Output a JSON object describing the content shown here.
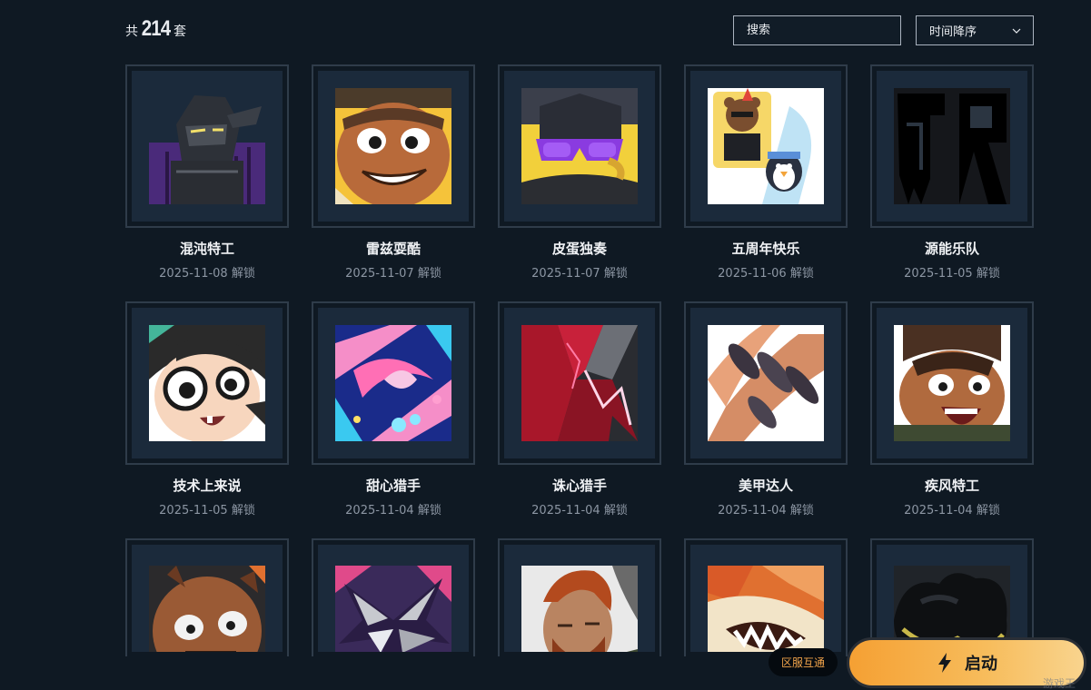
{
  "header": {
    "count_prefix": "共",
    "count_number": "214",
    "count_suffix": "套",
    "search_placeholder": "搜索",
    "sort_label": "时间降序"
  },
  "cards": [
    {
      "name": "混沌特工",
      "date": "2025-11-08 解锁",
      "art": "armor-robot"
    },
    {
      "name": "雷兹耍酷",
      "date": "2025-11-07 解锁",
      "art": "grin-face"
    },
    {
      "name": "皮蛋独奏",
      "date": "2025-11-07 解锁",
      "art": "sunglasses"
    },
    {
      "name": "五周年快乐",
      "date": "2025-11-06 解锁",
      "art": "bear-penguin"
    },
    {
      "name": "源能乐队",
      "date": "2025-11-05 解锁",
      "art": "band-logo"
    },
    {
      "name": "技术上来说",
      "date": "2025-11-05 解锁",
      "art": "glasses-girl"
    },
    {
      "name": "甜心猎手",
      "date": "2025-11-04 解锁",
      "art": "candy-pattern"
    },
    {
      "name": "诛心猎手",
      "date": "2025-11-04 解锁",
      "art": "red-shards"
    },
    {
      "name": "美甲达人",
      "date": "2025-11-04 解锁",
      "art": "nails"
    },
    {
      "name": "疾风特工",
      "date": "2025-11-04 解锁",
      "art": "shout-face"
    },
    {
      "name": "",
      "date": "",
      "art": "monkey-face"
    },
    {
      "name": "",
      "date": "",
      "art": "star-emblem"
    },
    {
      "name": "",
      "date": "",
      "art": "ginger-man"
    },
    {
      "name": "",
      "date": "",
      "art": "fox-teeth"
    },
    {
      "name": "",
      "date": "",
      "art": "dark-cloud"
    }
  ],
  "footer": {
    "region_tag": "区服互通",
    "launch_label": "启动",
    "watermark": "游戏王"
  }
}
